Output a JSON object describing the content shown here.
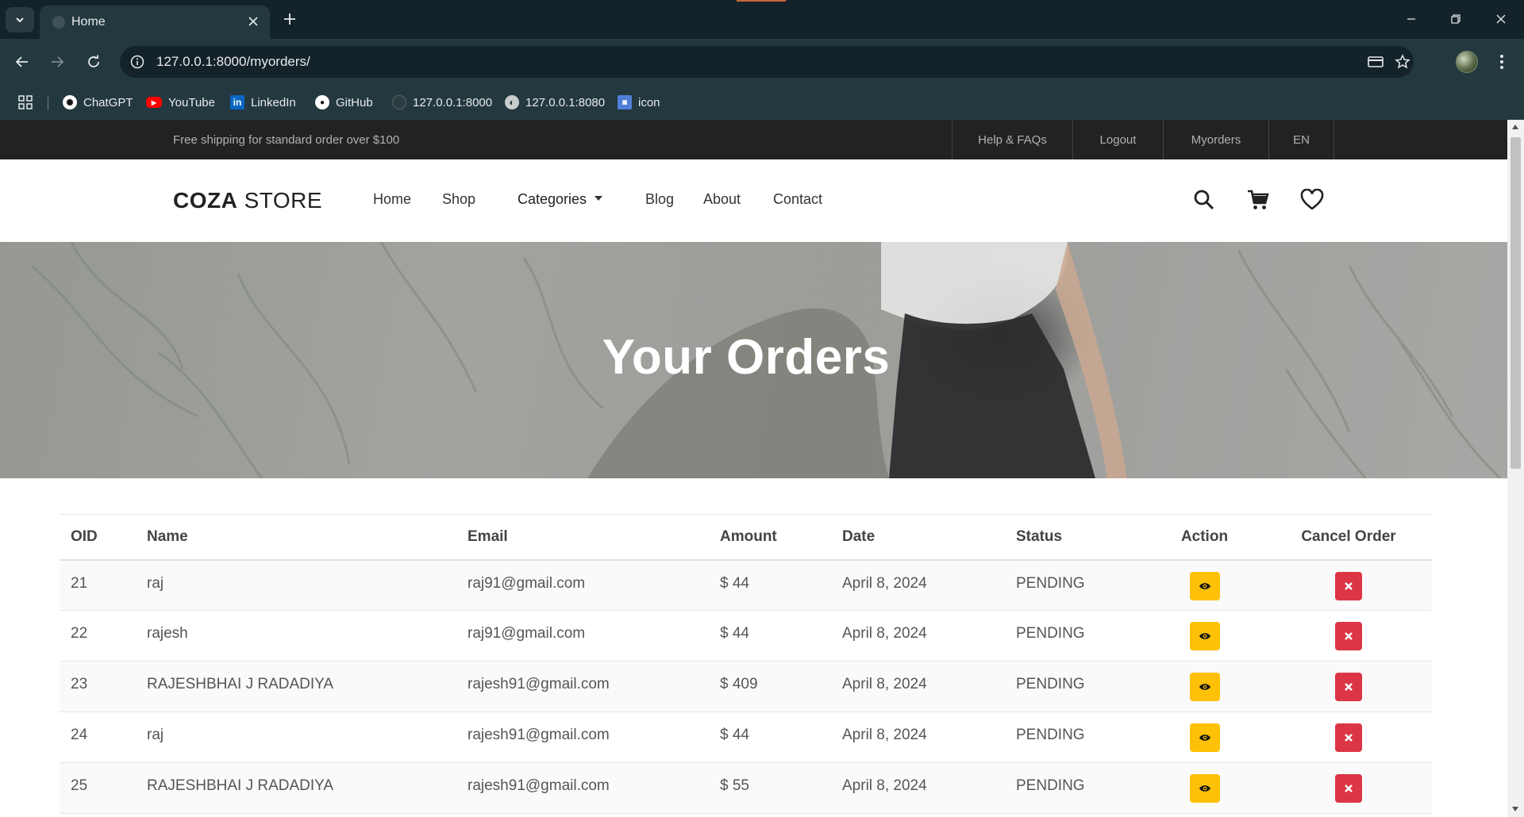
{
  "browser": {
    "tab_title": "Home",
    "url": "127.0.0.1:8000/myorders/",
    "bookmarks": [
      {
        "label": "ChatGPT",
        "icon": "chatgpt-icon"
      },
      {
        "label": "YouTube",
        "icon": "youtube-icon"
      },
      {
        "label": "LinkedIn",
        "icon": "linkedin-icon"
      },
      {
        "label": "GitHub",
        "icon": "github-icon"
      },
      {
        "label": "127.0.0.1:8000",
        "icon": "globe-icon"
      },
      {
        "label": "127.0.0.1:8080",
        "icon": "globe-icon"
      },
      {
        "label": "icon",
        "icon": "icon-bookmark-icon"
      }
    ]
  },
  "topbar": {
    "shipping_text": "Free shipping for standard order over $100",
    "links": [
      "Help & FAQs",
      "Logout",
      "Myorders",
      "EN"
    ]
  },
  "header": {
    "logo_bold": "COZA",
    "logo_light": " STORE",
    "menu": [
      "Home",
      "Shop",
      "Categories",
      "Blog",
      "About",
      "Contact"
    ]
  },
  "banner": {
    "title": "Your Orders"
  },
  "orders": {
    "columns": [
      "OID",
      "Name",
      "Email",
      "Amount",
      "Date",
      "Status",
      "Action",
      "Cancel Order"
    ],
    "rows": [
      {
        "oid": "21",
        "name": "raj",
        "email": "raj91@gmail.com",
        "amount": "$ 44",
        "date": "April 8, 2024",
        "status": "PENDING"
      },
      {
        "oid": "22",
        "name": "rajesh",
        "email": "raj91@gmail.com",
        "amount": "$ 44",
        "date": "April 8, 2024",
        "status": "PENDING"
      },
      {
        "oid": "23",
        "name": "RAJESHBHAI J RADADIYA",
        "email": "rajesh91@gmail.com",
        "amount": "$ 409",
        "date": "April 8, 2024",
        "status": "PENDING"
      },
      {
        "oid": "24",
        "name": "raj",
        "email": "rajesh91@gmail.com",
        "amount": "$ 44",
        "date": "April 8, 2024",
        "status": "PENDING"
      },
      {
        "oid": "25",
        "name": "RAJESHBHAI J RADADIYA",
        "email": "rajesh91@gmail.com",
        "amount": "$ 55",
        "date": "April 8, 2024",
        "status": "PENDING"
      }
    ]
  },
  "colors": {
    "view_button": "#ffc107",
    "cancel_button": "#dc3545",
    "topbar_bg": "#222222",
    "browser_frame": "#23393f"
  }
}
